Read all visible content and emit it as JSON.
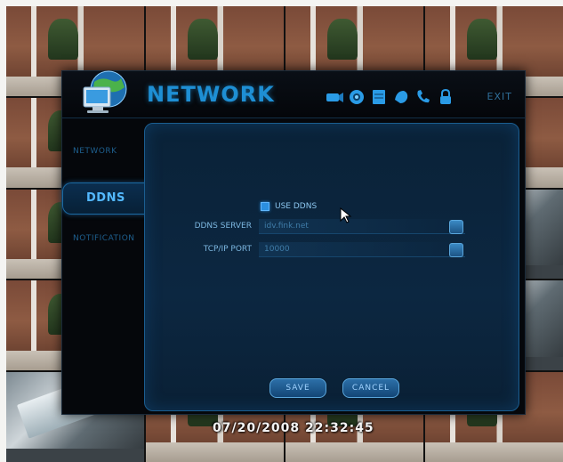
{
  "window": {
    "title": "NETWORK",
    "exit_label": "EXIT"
  },
  "toolbar": {
    "icons": [
      "camera-icon",
      "record-icon",
      "storage-icon",
      "ptz-icon",
      "network-icon",
      "lock-icon"
    ]
  },
  "sidebar": {
    "items": [
      {
        "label": "NETWORK",
        "active": false
      },
      {
        "label": "DDNS",
        "active": true
      },
      {
        "label": "NOTIFICATION",
        "active": false
      }
    ]
  },
  "form": {
    "use_ddns": {
      "label": "USE DDNS",
      "checked": true
    },
    "ddns_server": {
      "label": "DDNS SERVER",
      "value": "idv.fink.net"
    },
    "tcpip_port": {
      "label": "TCP/IP PORT",
      "value": "10000"
    }
  },
  "buttons": {
    "save": "SAVE",
    "cancel": "CANCEL"
  },
  "overlay": {
    "timestamp": "07/20/2008 22:32:45"
  },
  "colors": {
    "accent": "#1e8fd4",
    "panel": "#0a2238",
    "text_dim": "#1e5f8e"
  }
}
